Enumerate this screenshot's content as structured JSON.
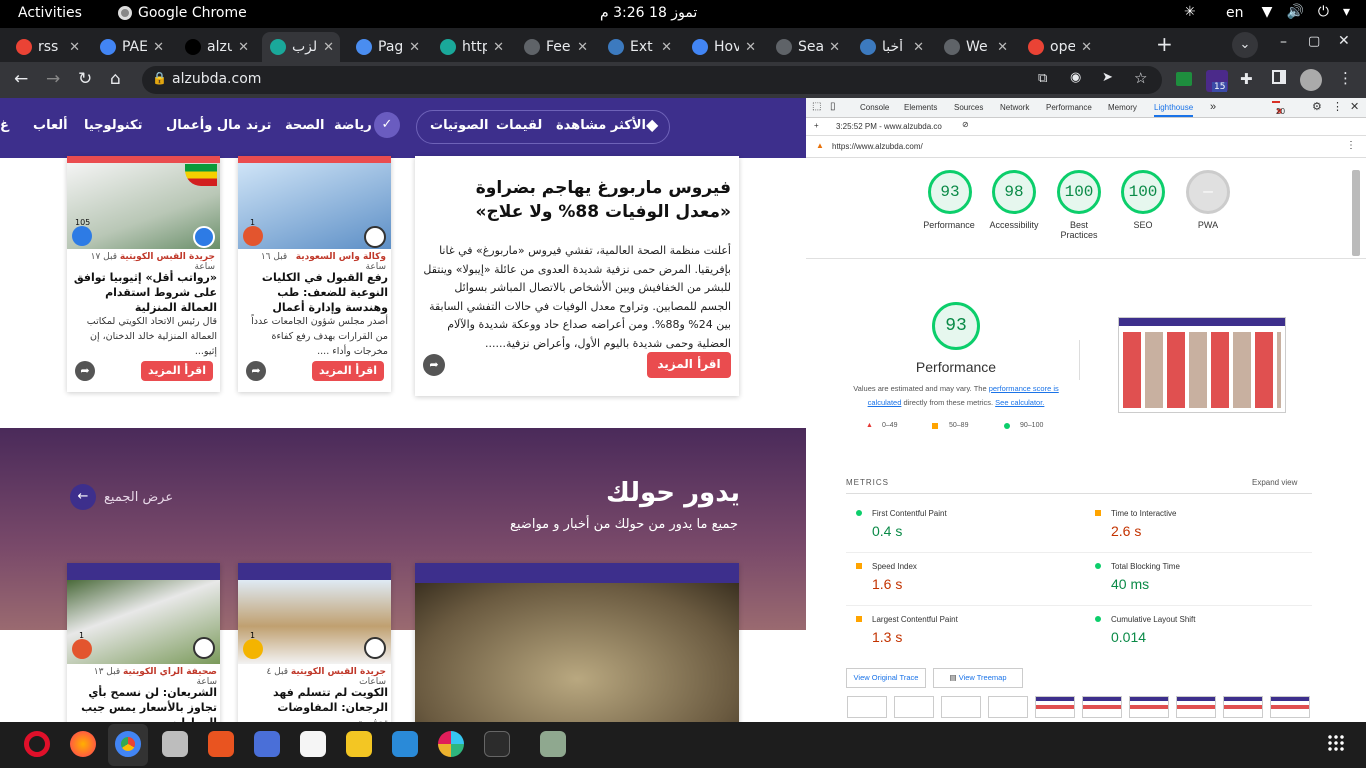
{
  "system": {
    "activities": "Activities",
    "app_name": "Google Chrome",
    "clock": "تموز 18  3:26 م",
    "lang": "en"
  },
  "tabs": [
    {
      "title": "rss",
      "color": "#ea4335"
    },
    {
      "title": "PAE",
      "color": "#4285f4"
    },
    {
      "title": "alzu",
      "color": "#000000"
    },
    {
      "title": "الزب",
      "color": "#1aa89a",
      "active": true
    },
    {
      "title": "Pag",
      "color": "#4a8df0"
    },
    {
      "title": "http",
      "color": "#1aa89a"
    },
    {
      "title": "Fee",
      "color": "#5f6368"
    },
    {
      "title": "Ext",
      "color": "#3c7abf"
    },
    {
      "title": "Hov",
      "color": "#4285f4"
    },
    {
      "title": "Sea",
      "color": "#5f6368"
    },
    {
      "title": "أخبا",
      "color": "#3c7abf"
    },
    {
      "title": "We",
      "color": "#5f6368"
    },
    {
      "title": "ope",
      "color": "#ea4335"
    }
  ],
  "toolbar": {
    "url": "alzubda.com",
    "ext_badge": "15"
  },
  "site": {
    "nav": [
      "الأكثر مشاهدة",
      "لقيمات",
      "الصوتيات",
      "رياضة",
      "الصحة",
      "ترند",
      "مال وأعمال",
      "تكنولوجيا",
      "ألعاب",
      "غ"
    ],
    "feature": {
      "title": "فيروس ماربورغ يهاجم بضراوة «معدل الوفيات 88% ولا علاج»",
      "body": "أعلنت منظمة الصحة العالمية، تفشي فيروس «ماربورغ» في غانا بإفريقيا. المرض حمى نزفية شديدة العدوى من عائلة «إيبولا» وينتقل للبشر من الخفافيش وبين الأشخاص بالاتصال المباشر بسوائل الجسم للمصابين. وتراوح معدل الوفيات في حالات التفشي السابقة بين 24% و88%. ومن أعراضه صداع حاد ووعكة شديدة والآلام العضلية وحمى شديدة باليوم الأول، وأعراض نزفية......",
      "more": "اقرأ المزيد"
    },
    "card1": {
      "source": "وكالة واس السعودية",
      "time": "قبل ١٦ ساعة",
      "title": "رفع القبول في الكليات النوعية للضعف: طب وهندسة وإدارة أعمال",
      "body": "أصدر مجلس شؤون الجامعات عدداً من القرارات بهدف رفع كفاءة مخرجات وأداء ....",
      "more": "اقرأ المزيد",
      "count": "1"
    },
    "card2": {
      "source": "جريدة القبس الكويتية",
      "time": "قبل ١٧ ساعة",
      "title": "«رواتب أقل» إثيوبيا توافق على شروط استقدام العمالة المنزلية",
      "body": "قال رئيس الاتحاد الكويتي لمكاتب العمالة المنزلية خالد الدخنان، إن إثيو...",
      "more": "اقرأ المزيد",
      "count": "105"
    },
    "section": {
      "title": "يدور حولك",
      "subtitle": "جميع ما يدور من حولك من أخبار و مواضيع",
      "view_all": "عرض الجميع"
    },
    "card3": {
      "source": "جريدة القبس الكويتية",
      "time": "قبل ٤ ساعات",
      "title": "الكويت لم تتسلم فهد الرجعان: المفاوضات تعثرت",
      "count": "1"
    },
    "card4": {
      "source": "صحيفة الراي الكويتية",
      "time": "قبل ١٣ ساعة",
      "title": "الشريعان: لن نسمح بأي تجاوز بالأسعار يمس جيب المواطن",
      "count": "1"
    }
  },
  "devtools": {
    "tabs": [
      "Console",
      "Elements",
      "Sources",
      "Network",
      "Performance",
      "Memory",
      "Lighthouse"
    ],
    "active_tab": "Lighthouse",
    "errors": "20",
    "run": "3:25:52 PM - www.alzubda.co",
    "url": "https://www.alzubda.com/",
    "scores": [
      {
        "value": "93",
        "label": "Performance"
      },
      {
        "value": "98",
        "label": "Accessibility"
      },
      {
        "value": "100",
        "label": "Best Practices"
      },
      {
        "value": "100",
        "label": "SEO"
      },
      {
        "value": "—",
        "label": "PWA"
      }
    ],
    "perf_big": "93",
    "perf_title": "Performance",
    "note1": "Values are estimated and may vary. The ",
    "note_link": "performance score is calculated",
    "note2": " directly from these metrics. ",
    "note_link2": "See calculator.",
    "legend": [
      "0–49",
      "50–89",
      "90–100"
    ],
    "metrics_title": "METRICS",
    "expand": "Expand view",
    "metrics": [
      {
        "name": "First Contentful Paint",
        "value": "0.4 s",
        "status": "good"
      },
      {
        "name": "Time to Interactive",
        "value": "2.6 s",
        "status": "avg"
      },
      {
        "name": "Speed Index",
        "value": "1.6 s",
        "status": "avg"
      },
      {
        "name": "Total Blocking Time",
        "value": "40 ms",
        "status": "good"
      },
      {
        "name": "Largest Contentful Paint",
        "value": "1.3 s",
        "status": "avg"
      },
      {
        "name": "Cumulative Layout Shift",
        "value": "0.014",
        "status": "good"
      }
    ],
    "btn_trace": "View Original Trace",
    "btn_treemap": "View Treemap"
  }
}
